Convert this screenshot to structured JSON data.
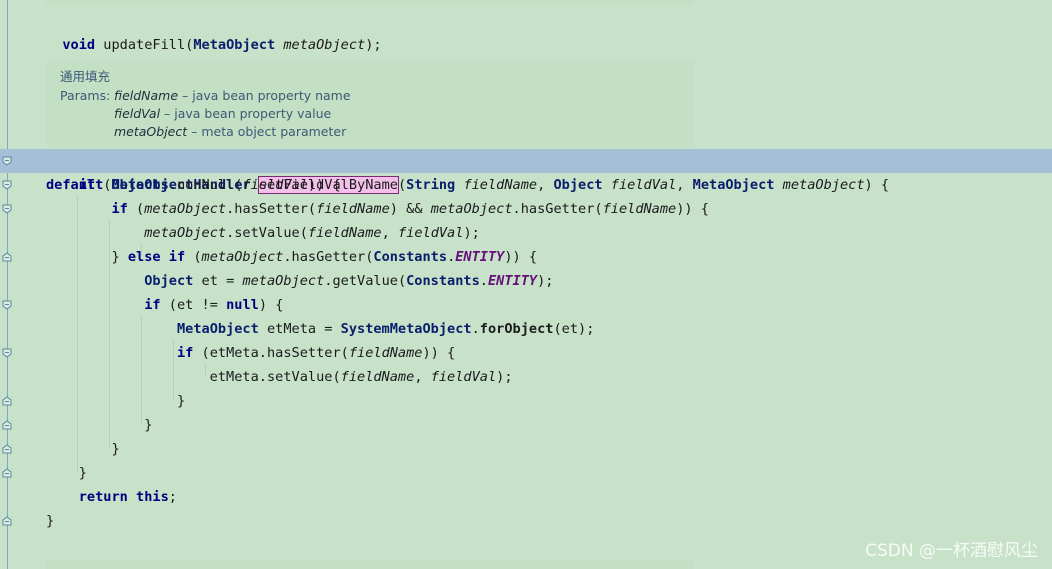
{
  "code": {
    "line_void": "void updateFill(MetaObject metaObject);",
    "doc": {
      "title": "通用填充",
      "params_label": "Params:",
      "params": [
        {
          "name": "fieldName",
          "desc": " – java bean property name"
        },
        {
          "name": "fieldVal",
          "desc": " – java bean property value"
        },
        {
          "name": "metaObject",
          "desc": " – meta object parameter"
        }
      ]
    },
    "decl": {
      "modifier": "default",
      "return_type": "MetaObjectHandler",
      "method_name": "setFieldValByName",
      "params_text_1": "(",
      "t1": "String",
      "p1": "fieldName",
      "sep1": ", ",
      "t2": "Object",
      "p2": "fieldVal",
      "sep2": ", ",
      "t3": "MetaObject",
      "p3": "metaObject",
      "end": ") {"
    }
  },
  "watermark": "CSDN @一杯酒慰风尘"
}
